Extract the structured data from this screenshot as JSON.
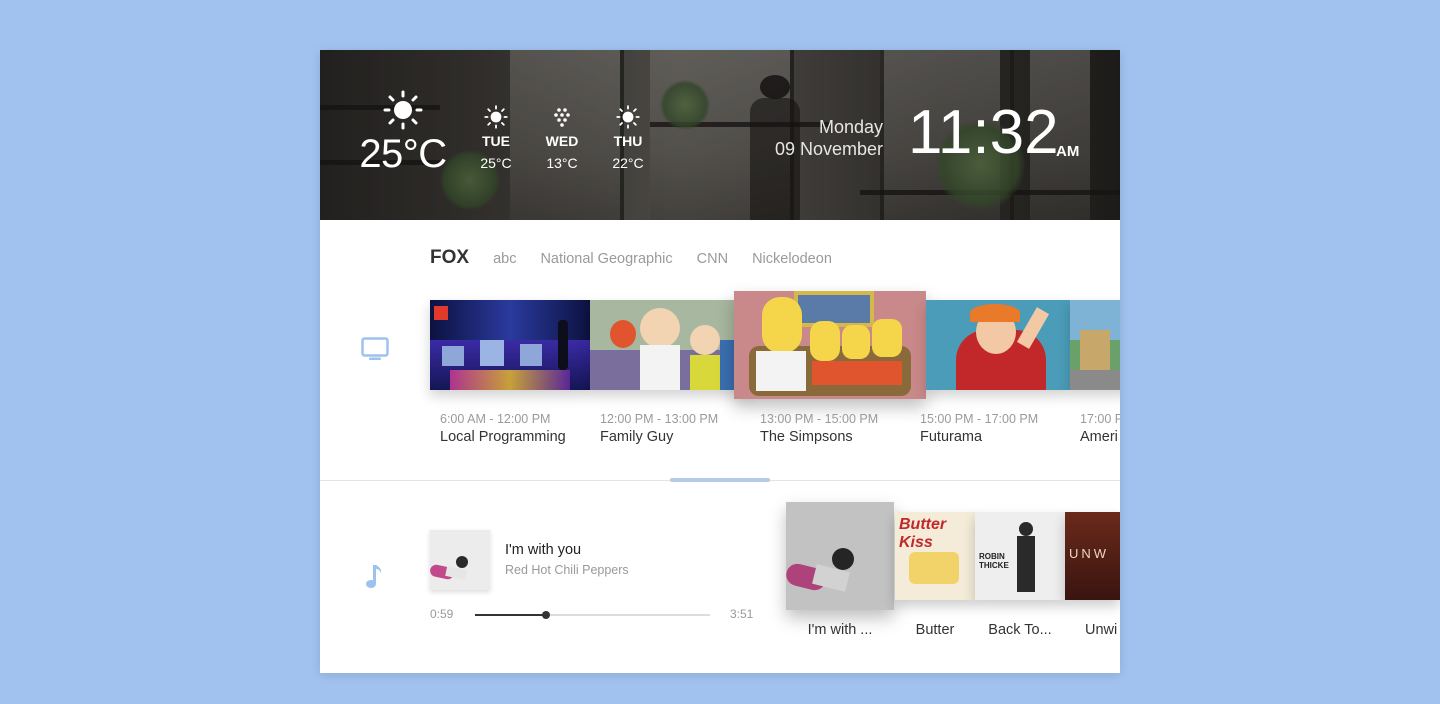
{
  "weather": {
    "current": {
      "icon": "sun-icon",
      "temp": "25°C"
    },
    "forecast": [
      {
        "day": "TUE",
        "temp": "25°C",
        "icon": "sun-icon"
      },
      {
        "day": "WED",
        "temp": "13°C",
        "icon": "snow-icon"
      },
      {
        "day": "THU",
        "temp": "22°C",
        "icon": "sun-icon"
      }
    ]
  },
  "datetime": {
    "weekday": "Monday",
    "date": "09 November",
    "time": "11:32",
    "ampm": "AM"
  },
  "tv": {
    "icon": "tv-icon",
    "channels": [
      "FOX",
      "abc",
      "National Geographic",
      "CNN",
      "Nickelodeon"
    ],
    "active_channel": "FOX",
    "shows": [
      {
        "time": "6:00 AM - 12:00 PM",
        "title": "Local Programming"
      },
      {
        "time": "12:00 PM - 13:00 PM",
        "title": "Family Guy"
      },
      {
        "time": "13:00 PM - 15:00 PM",
        "title": "The Simpsons"
      },
      {
        "time": "15:00 PM - 17:00 PM",
        "title": "Futurama"
      },
      {
        "time": "17:00 P",
        "title": "Ameri"
      }
    ]
  },
  "music": {
    "icon": "music-note-icon",
    "now_playing": {
      "title": "I'm with you",
      "artist": "Red Hot Chili Peppers",
      "elapsed": "0:59",
      "duration": "3:51",
      "progress": 0.3
    },
    "albums": [
      {
        "label": "I'm with ...",
        "art_text": ""
      },
      {
        "label": "Butter",
        "art_text": "Butter Kiss"
      },
      {
        "label": "Back To...",
        "art_text": "ROBIN THICKE"
      },
      {
        "label": "Unwi",
        "art_text": "UNW"
      }
    ]
  },
  "colors": {
    "background": "#a1c2ef",
    "accent": "#b4cbea",
    "icon_blue": "#9ec1ee"
  }
}
